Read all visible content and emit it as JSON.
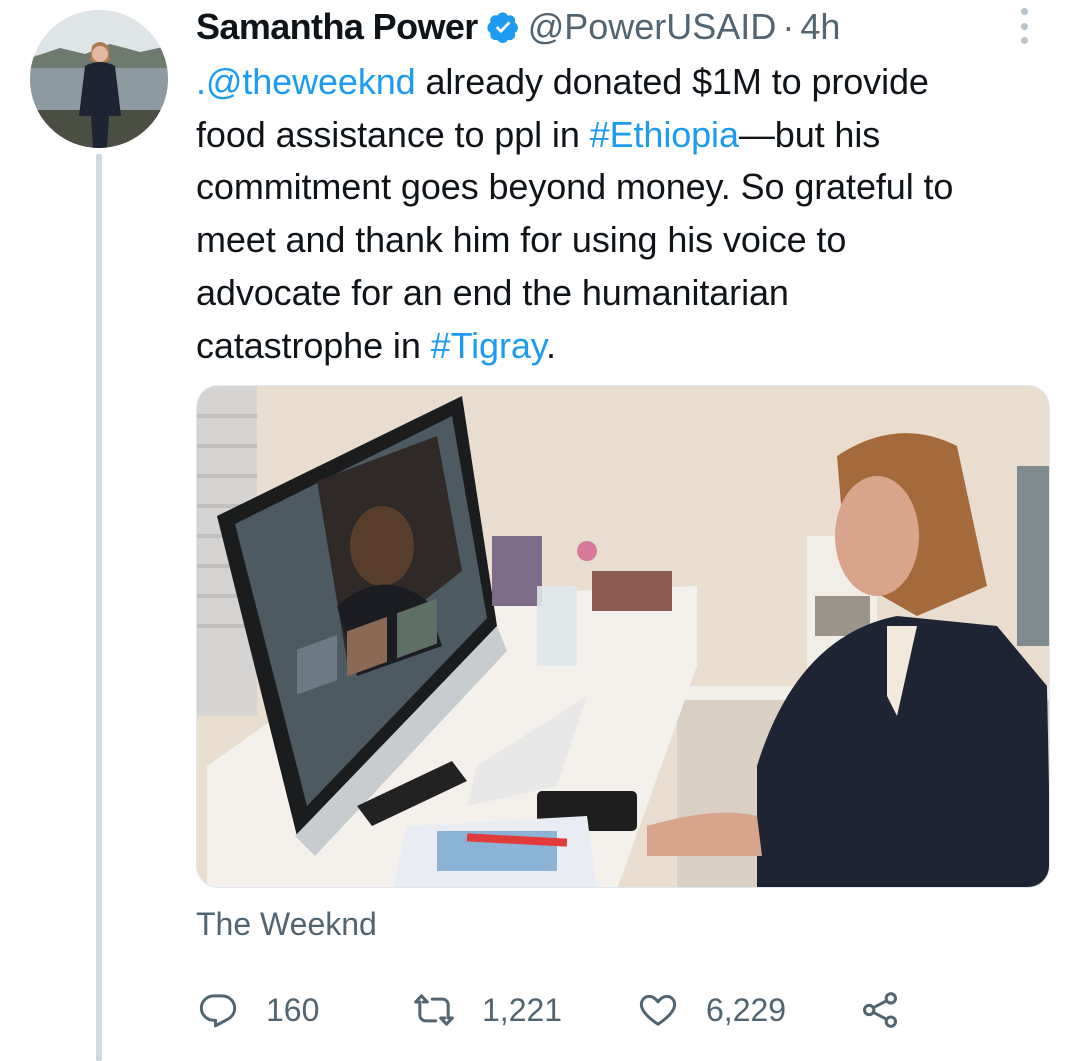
{
  "tweet": {
    "author_name": "Samantha Power",
    "handle": "@PowerUSAID",
    "separator": "·",
    "time": "4h",
    "text": {
      "l1_mention": ".@theweeknd",
      "l1_rest": " already donated $1M to provide",
      "l2_pre": "food assistance to ppl in ",
      "l2_tag": "#Ethiopia",
      "l2_rest": "—but his",
      "l3": "commitment goes beyond money. So grateful to",
      "l4": "meet and thank him for using his voice to",
      "l5": "advocate for an end the humanitarian",
      "l6_pre": "catastrophe in ",
      "l6_tag": "#Tigray",
      "l6_end": "."
    },
    "media_tag": "The Weeknd",
    "stats": {
      "replies": "160",
      "retweets": "1,221",
      "likes": "6,229"
    }
  },
  "icons": {
    "verified": "verified-badge-icon",
    "more": "more-vertical-icon",
    "reply": "reply-icon",
    "retweet": "retweet-icon",
    "like": "heart-icon",
    "share": "share-icon"
  },
  "colors": {
    "link": "#1d9bf0",
    "secondary_text": "#536471",
    "thread_line": "#cfd9de"
  }
}
